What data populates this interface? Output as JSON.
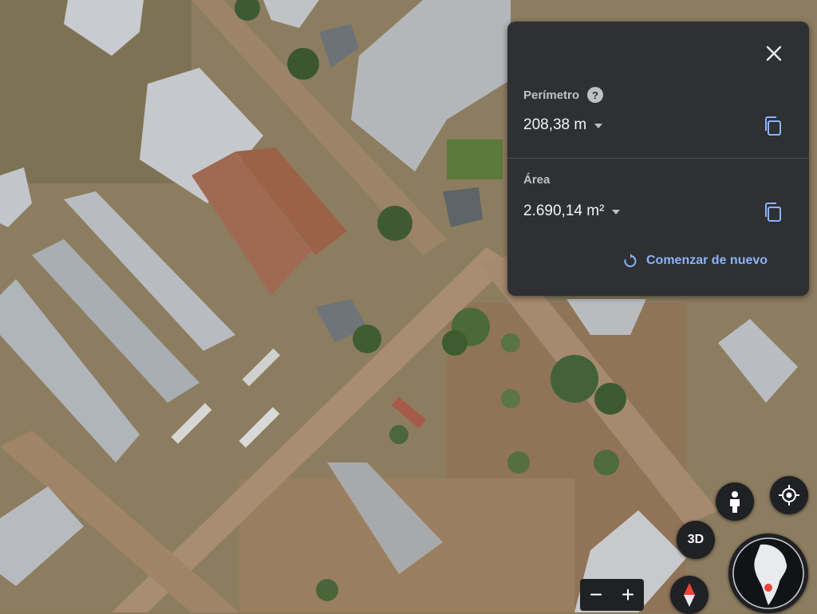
{
  "panel": {
    "perimeter_label": "Perímetro",
    "help_glyph": "?",
    "perimeter_value": "208,38 m",
    "area_label": "Área",
    "area_value": "2.690,14 m²",
    "restart_label": "Comenzar de nuevo"
  },
  "controls": {
    "btn_3d": "3D",
    "zoom_out": "−",
    "zoom_in": "+"
  },
  "colors": {
    "panel_bg": "#2f3033",
    "accent_link": "#8ab4f8",
    "control_bg": "#202124"
  },
  "icons": [
    "close-icon",
    "help-icon",
    "copy-icon",
    "restart-icon",
    "pegman-icon",
    "my-location-icon",
    "compass-icon",
    "globe-icon"
  ]
}
